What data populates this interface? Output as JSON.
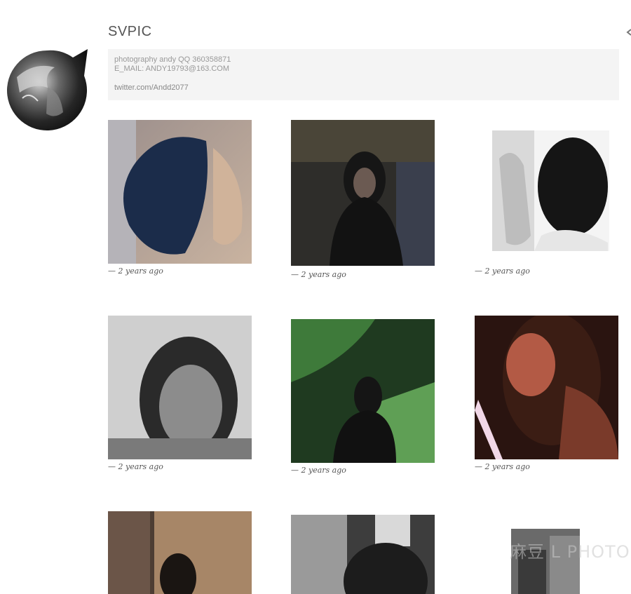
{
  "site": {
    "title": "SVPIC"
  },
  "description": {
    "line1": "photography andy QQ 360358871",
    "line2": "E_MAIL: ANDY19793@163.COM",
    "link": "twitter.com/Andd2077"
  },
  "posts": [
    {
      "meta": "— 2 years ago"
    },
    {
      "meta": "— 2 years ago"
    },
    {
      "meta": "— 2 years ago"
    },
    {
      "meta": "— 2 years ago"
    },
    {
      "meta": "— 2 years ago"
    },
    {
      "meta": "— 2 years ago"
    },
    {
      "meta": ""
    },
    {
      "meta": ""
    },
    {
      "meta": ""
    }
  ],
  "watermark": "麻豆 L PHOTOG"
}
